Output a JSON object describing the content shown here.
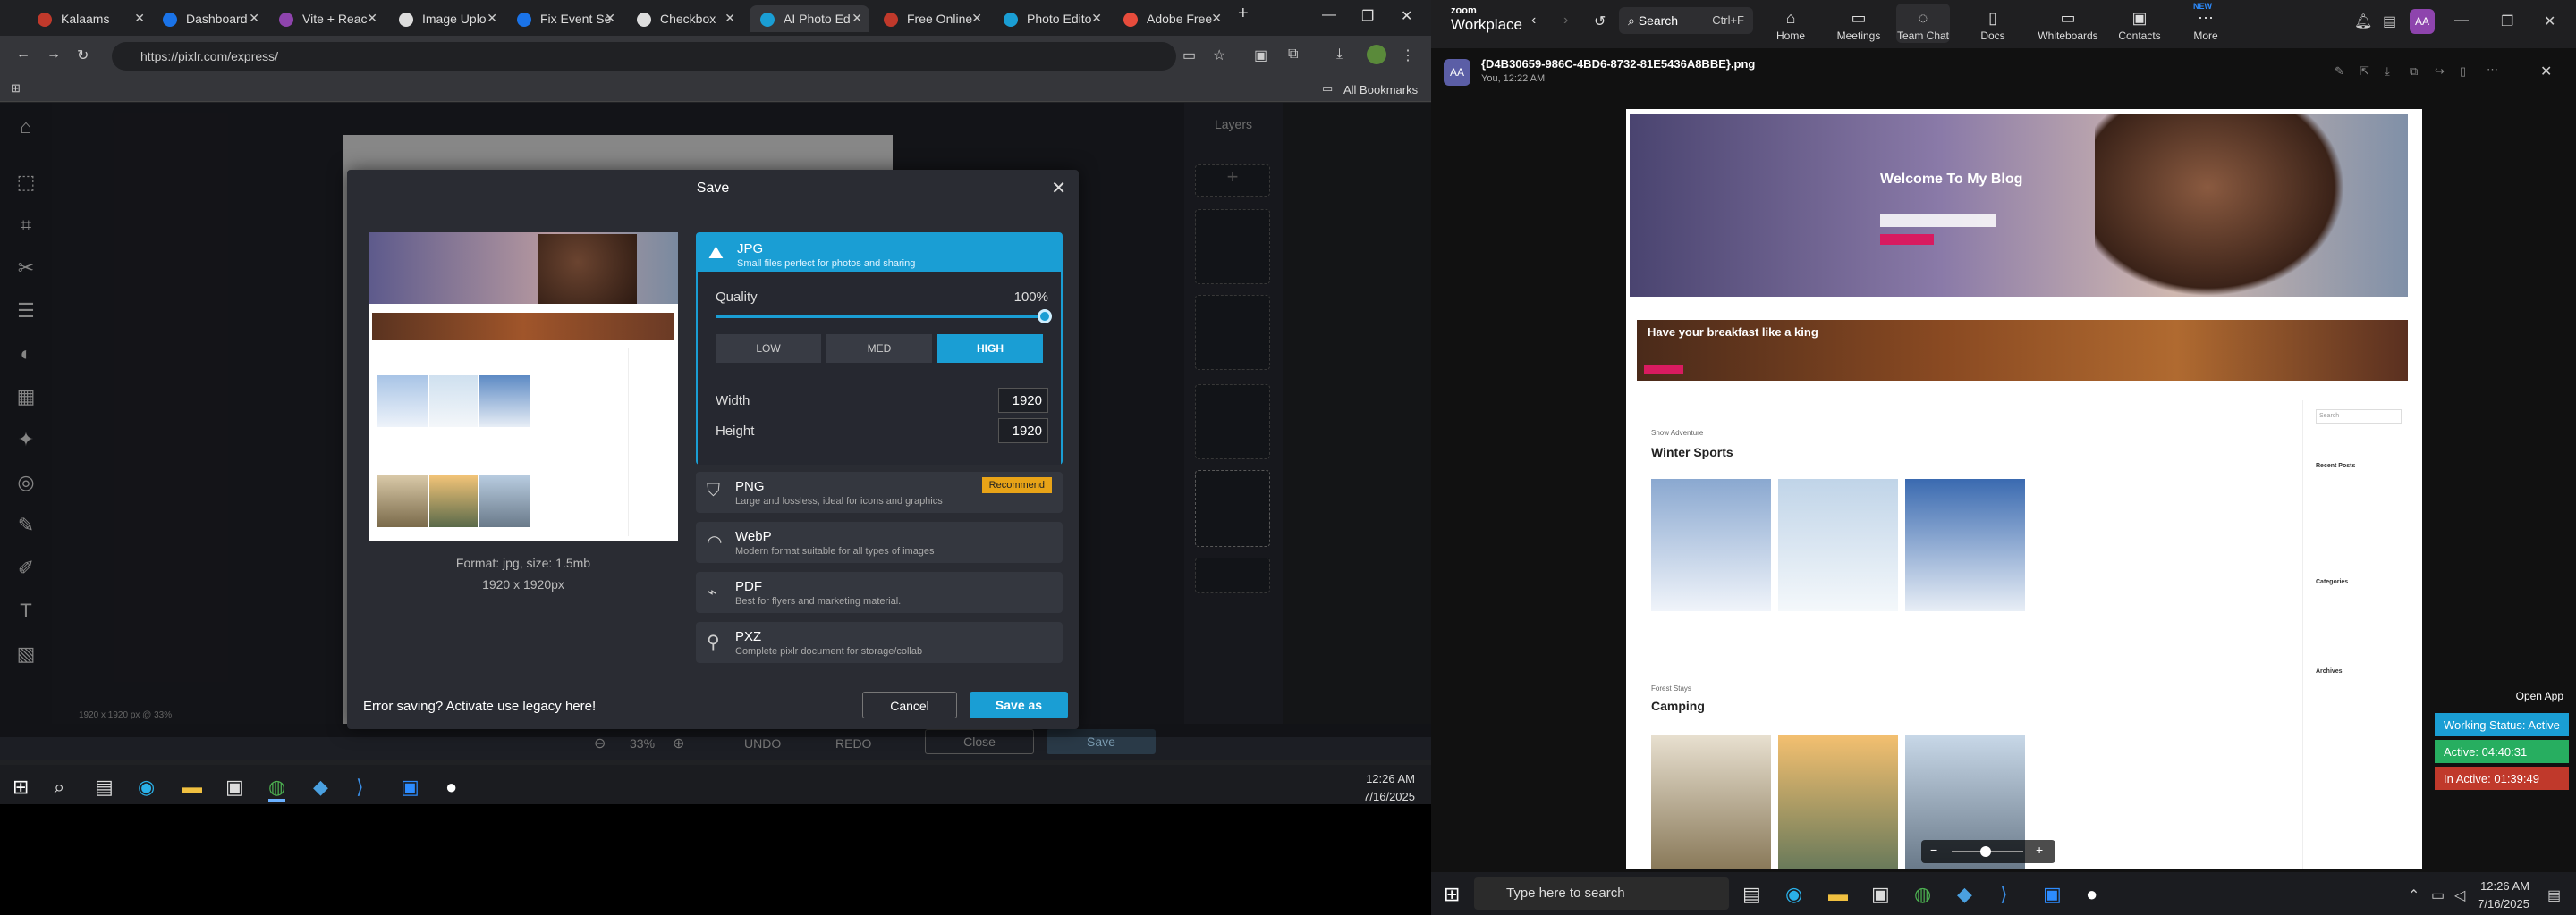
{
  "browser": {
    "tabs": [
      {
        "label": "Kalaams",
        "color": "#c0392b"
      },
      {
        "label": "Dashboard",
        "color": "#1a73e8"
      },
      {
        "label": "Vite + Reac",
        "color": "#8e44ad"
      },
      {
        "label": "Image Uplo",
        "color": "#ddd"
      },
      {
        "label": "Fix Event Se",
        "color": "#1a73e8"
      },
      {
        "label": "Checkbox",
        "color": "#ddd"
      },
      {
        "label": "AI Photo Ed",
        "color": "#1a9ed4"
      },
      {
        "label": "Free Online",
        "color": "#c0392b"
      },
      {
        "label": "Photo Edito",
        "color": "#1a9ed4"
      },
      {
        "label": "Adobe Free",
        "color": "#e74c3c"
      }
    ],
    "url": "https://pixlr.com/express/",
    "bookmarks_label": "All Bookmarks"
  },
  "pixlr": {
    "layers_title": "Layers",
    "canvas_info": "1920 x 1920 px @ 33%",
    "zoom_level": "33%",
    "undo": "UNDO",
    "redo": "REDO",
    "close": "Close",
    "save": "Save"
  },
  "dialog": {
    "title": "Save",
    "format_info": "Format: jpg, size: 1.5mb",
    "dims_info": "1920 x 1920px",
    "jpg": {
      "title": "JPG",
      "desc": "Small files perfect for photos and sharing"
    },
    "quality_label": "Quality",
    "quality_value": "100%",
    "quality_pct": 100,
    "quality_buttons": [
      "LOW",
      "MED",
      "HIGH"
    ],
    "width_label": "Width",
    "width_value": "1920",
    "height_label": "Height",
    "height_value": "1920",
    "png": {
      "title": "PNG",
      "desc": "Large and lossless, ideal for icons and graphics",
      "badge": "Recommend"
    },
    "webp": {
      "title": "WebP",
      "desc": "Modern format suitable for all types of images"
    },
    "pdf": {
      "title": "PDF",
      "desc": "Best for flyers and marketing material."
    },
    "pxz": {
      "title": "PXZ",
      "desc": "Complete pixlr document for storage/collab"
    },
    "error_text": "Error saving? Activate use legacy here!",
    "cancel": "Cancel",
    "save_as": "Save as"
  },
  "taskbar_left": {
    "time": "12:26 AM",
    "date": "7/16/2025"
  },
  "zoom": {
    "brand_top": "zoom",
    "brand": "Workplace",
    "search": "Search",
    "search_shortcut": "Ctrl+F",
    "menu": [
      "Home",
      "Meetings",
      "Team Chat",
      "Docs",
      "Whiteboards",
      "Contacts",
      "More"
    ],
    "new_badge": "NEW",
    "avatar": "AA",
    "filename": "{D4B30659-986C-4BD6-8732-81E5436A8BBE}.png",
    "sender_meta": "You, 12:22 AM",
    "open_app": "Open App",
    "status_working": "Working Status: Active",
    "status_active": "Active: 04:40:31",
    "status_inactive": "In Active: 01:39:49",
    "search_placeholder": "Type here to search",
    "time": "12:26 AM",
    "date": "7/16/2025"
  },
  "website": {
    "hero_title": "Welcome To My Blog",
    "banner_text": "Have your breakfast like a king",
    "section1_label": "Snow Adventure",
    "section1_title": "Winter Sports",
    "section2_label": "Forest Stays",
    "section2_title": "Camping",
    "sidebar_search": "Search",
    "recent_posts": "Recent Posts",
    "categories": "Categories",
    "archives": "Archives"
  },
  "colors": {
    "accent": "#1a9ed4",
    "recommend": "#e8a317",
    "status_blue": "#1a9ed4",
    "status_green": "#27ae60",
    "status_red": "#c0392b"
  }
}
